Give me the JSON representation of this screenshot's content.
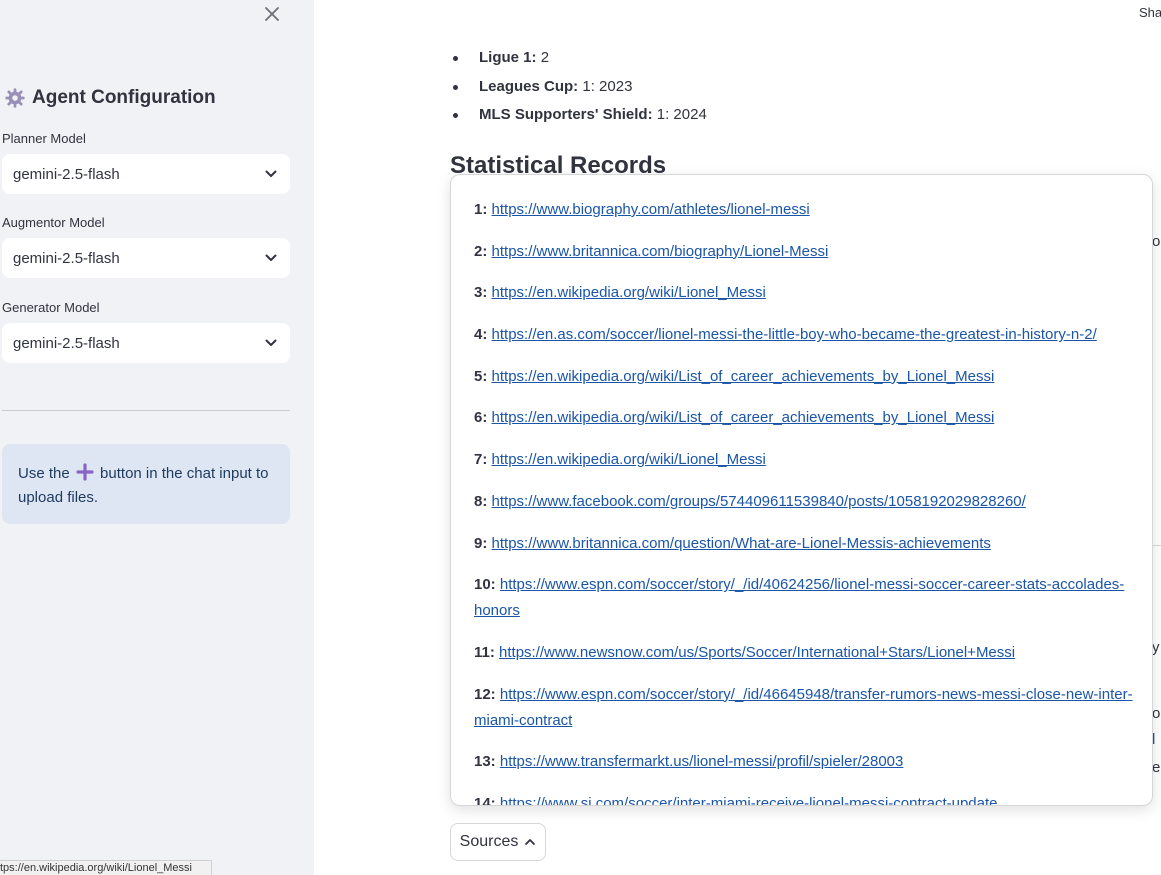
{
  "sidebar": {
    "title": "Agent Configuration",
    "fields": [
      {
        "label": "Planner Model",
        "value": "gemini-2.5-flash"
      },
      {
        "label": "Augmentor Model",
        "value": "gemini-2.5-flash"
      },
      {
        "label": "Generator Model",
        "value": "gemini-2.5-flash"
      }
    ],
    "info_text_before": "Use the",
    "info_text_after": "button in the chat input to upload files.",
    "status_url": "tps://en.wikipedia.org/wiki/Lionel_Messi"
  },
  "header": {
    "share_label": "Sha"
  },
  "main": {
    "bullets": [
      {
        "label": "Ligue 1:",
        "value": "2"
      },
      {
        "label": "Leagues Cup:",
        "value": "1: 2023"
      },
      {
        "label": "MLS Supporters' Shield:",
        "value": "1: 2024"
      }
    ],
    "section_heading": "Statistical Records",
    "edge_fragments": [
      "o",
      "y",
      "o",
      "l",
      "e"
    ]
  },
  "sources": {
    "button_label": "Sources",
    "items": [
      {
        "num": "1:",
        "url": "https://www.biography.com/athletes/lionel-messi"
      },
      {
        "num": "2:",
        "url": "https://www.britannica.com/biography/Lionel-Messi"
      },
      {
        "num": "3:",
        "url": "https://en.wikipedia.org/wiki/Lionel_Messi"
      },
      {
        "num": "4:",
        "url": "https://en.as.com/soccer/lionel-messi-the-little-boy-who-became-the-greatest-in-history-n-2/"
      },
      {
        "num": "5:",
        "url": "https://en.wikipedia.org/wiki/List_of_career_achievements_by_Lionel_Messi"
      },
      {
        "num": "6:",
        "url": "https://en.wikipedia.org/wiki/List_of_career_achievements_by_Lionel_Messi"
      },
      {
        "num": "7:",
        "url": "https://en.wikipedia.org/wiki/Lionel_Messi"
      },
      {
        "num": "8:",
        "url": "https://www.facebook.com/groups/574409611539840/posts/1058192029828260/"
      },
      {
        "num": "9:",
        "url": "https://www.britannica.com/question/What-are-Lionel-Messis-achievements"
      },
      {
        "num": "10:",
        "url": "https://www.espn.com/soccer/story/_/id/40624256/lionel-messi-soccer-career-stats-accolades-honors"
      },
      {
        "num": "11:",
        "url": "https://www.newsnow.com/us/Sports/Soccer/International+Stars/Lionel+Messi"
      },
      {
        "num": "12:",
        "url": "https://www.espn.com/soccer/story/_/id/46645948/transfer-rumors-news-messi-close-new-inter-miami-contract"
      },
      {
        "num": "13:",
        "url": "https://www.transfermarkt.us/lionel-messi/profil/spieler/28003"
      },
      {
        "num": "14:",
        "url": "https://www.si.com/soccer/inter-miami-receive-lionel-messi-contract-update"
      }
    ]
  }
}
